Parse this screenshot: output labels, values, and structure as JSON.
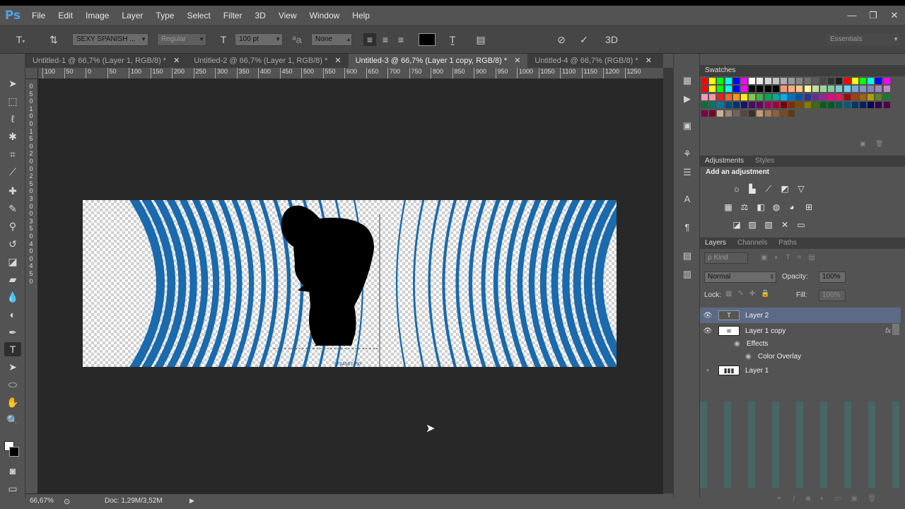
{
  "app": {
    "logo": "Ps"
  },
  "menu": [
    "File",
    "Edit",
    "Image",
    "Layer",
    "Type",
    "Select",
    "Filter",
    "3D",
    "View",
    "Window",
    "Help"
  ],
  "window_controls": {
    "minimize": "—",
    "restore": "❐",
    "close": "✕"
  },
  "options": {
    "font_family": "SEXY SPANISH ...",
    "font_style": "Regular",
    "font_size": "100 pt",
    "anti_alias": "None",
    "workspace": "Essentials",
    "text_color": "#000000"
  },
  "tabs": [
    {
      "label": "Untitled-1 @ 66,7% (Layer 1, RGB/8) *",
      "active": false
    },
    {
      "label": "Untitled-2 @ 66,7% (Layer 1, RGB/8) *",
      "active": false
    },
    {
      "label": "Untitled-3 @ 66,7% (Layer 1 copy, RGB/8) *",
      "active": true
    },
    {
      "label": "Untitled-4 @ 66,7% (RGB/8) *",
      "active": false
    }
  ],
  "ruler_h": [
    "100",
    "50",
    "0",
    "50",
    "100",
    "150",
    "200",
    "250",
    "300",
    "350",
    "400",
    "450",
    "500",
    "550",
    "600",
    "650",
    "700",
    "750",
    "800",
    "850",
    "900",
    "950",
    "1000",
    "1050",
    "1100",
    "1150",
    "1200",
    "1250"
  ],
  "ruler_v": [
    "0",
    "5",
    "0",
    "1",
    "0",
    "0",
    "1",
    "5",
    "0",
    "2",
    "0",
    "0",
    "2",
    "5",
    "0",
    "3",
    "0",
    "0",
    "3",
    "5",
    "0",
    "4",
    "0",
    "0",
    "4",
    "5",
    "0"
  ],
  "status": {
    "zoom": "66,67%",
    "doc": "Doc: 1,29M/3,52M"
  },
  "canvas": {
    "line_color": "#1a6aad",
    "silhouette_color": "#000000",
    "caption": "3234567890"
  },
  "swatches_panel": {
    "title": "Swatches",
    "colors": [
      "#ff0000",
      "#ffff00",
      "#00ff00",
      "#00ffff",
      "#0000ff",
      "#ff00ff",
      "#ffffff",
      "#ebebeb",
      "#d6d6d6",
      "#c2c2c2",
      "#adadad",
      "#999999",
      "#858585",
      "#707070",
      "#5c5c5c",
      "#474747",
      "#333333",
      "#1f1f1f",
      "#ff0000",
      "#ffff00",
      "#00ff00",
      "#00ffff",
      "#0000ff",
      "#ff00ff",
      "#ff0000",
      "#ffff00",
      "#00ff00",
      "#00ffff",
      "#0000ff",
      "#ff00ff",
      "#0a0a0a",
      "#000000",
      "#000000",
      "#000000",
      "#f7977a",
      "#f9ad81",
      "#fdc68a",
      "#fff79a",
      "#c4df9b",
      "#a2d39c",
      "#82ca9d",
      "#7bcdc8",
      "#6ecff6",
      "#7ea7d8",
      "#8493ca",
      "#8882be",
      "#a187be",
      "#bc8dbf",
      "#f49ac2",
      "#f6989d",
      "#ed1c24",
      "#f26522",
      "#f7941d",
      "#fff200",
      "#8dc63f",
      "#39b54a",
      "#00a651",
      "#00a99d",
      "#00aeef",
      "#0072bc",
      "#0054a6",
      "#2e3192",
      "#662d91",
      "#92278f",
      "#ec008c",
      "#ed145b",
      "#9e0b0f",
      "#a0410d",
      "#a36209",
      "#aba000",
      "#598527",
      "#1a7b30",
      "#007236",
      "#00746b",
      "#0076a3",
      "#004a80",
      "#003471",
      "#1b1464",
      "#440e62",
      "#630460",
      "#9e005d",
      "#9e0039",
      "#790000",
      "#7b2e00",
      "#7d4900",
      "#827b00",
      "#406618",
      "#005e20",
      "#005826",
      "#005952",
      "#005b7f",
      "#003663",
      "#002157",
      "#0d004c",
      "#32004b",
      "#4b0049",
      "#7b0046",
      "#7a0026",
      "#c7b299",
      "#998675",
      "#736357",
      "#534741",
      "#37302d",
      "#c69c6d",
      "#a67c52",
      "#8c6239",
      "#754c24",
      "#603913"
    ]
  },
  "adjustments_panel": {
    "tab1": "Adjustments",
    "tab2": "Styles",
    "title": "Add an adjustment"
  },
  "layers_panel": {
    "tabs": [
      "Layers",
      "Channels",
      "Paths"
    ],
    "kind": "ρ Kind",
    "blend": "Normal",
    "opacity_label": "Opacity:",
    "opacity": "100%",
    "lock_label": "Lock:",
    "fill_label": "Fill:",
    "fill": "100%",
    "layers": [
      {
        "name": "Layer 2",
        "type": "text",
        "selected": true,
        "visible": true
      },
      {
        "name": "Layer 1 copy",
        "type": "pixel",
        "selected": false,
        "visible": true,
        "fx": "fx"
      },
      {
        "name": "Effects",
        "type": "effects",
        "selected": false,
        "visible": true
      },
      {
        "name": "Color Overlay",
        "type": "effect",
        "selected": false,
        "visible": true
      },
      {
        "name": "Layer 1",
        "type": "pixel",
        "selected": false,
        "visible": false
      }
    ]
  }
}
